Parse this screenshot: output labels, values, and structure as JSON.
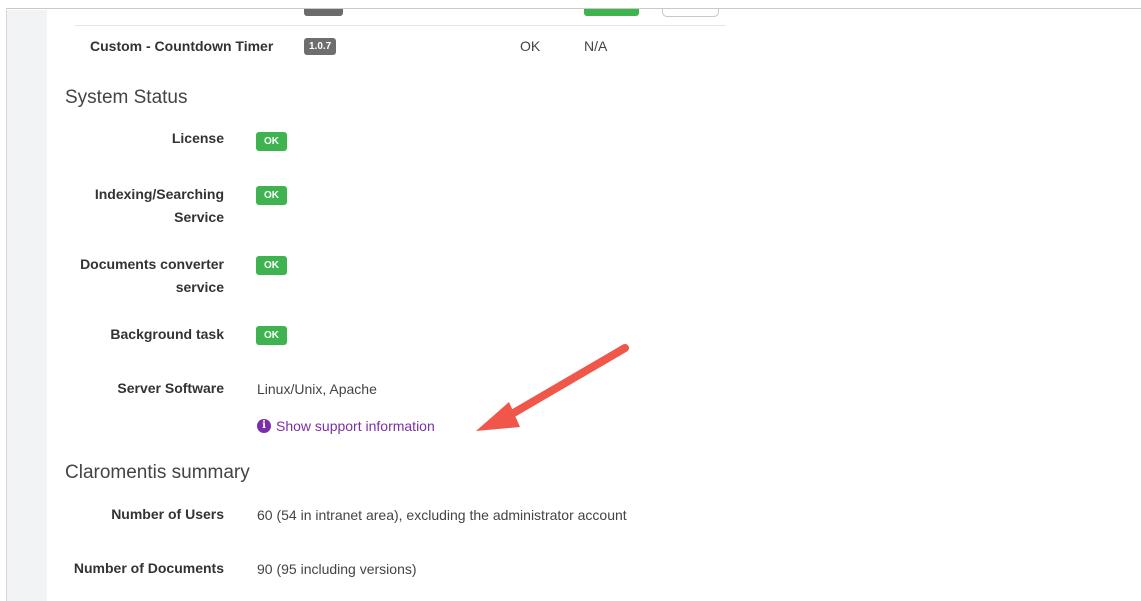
{
  "plugins": {
    "row": {
      "name": "Custom - Countdown Timer",
      "version": "1.0.7",
      "status": "OK",
      "extra": "N/A"
    }
  },
  "system_status": {
    "title": "System Status",
    "items": [
      {
        "label_line1": "License",
        "label_line2": "",
        "badge": "OK"
      },
      {
        "label_line1": "Indexing/Searching",
        "label_line2": "Service",
        "badge": "OK"
      },
      {
        "label_line1": "Documents converter",
        "label_line2": "service",
        "badge": "OK"
      },
      {
        "label_line1": "Background task",
        "label_line2": "",
        "badge": "OK"
      }
    ],
    "server_software": {
      "label": "Server Software",
      "value": "Linux/Unix, Apache"
    },
    "support_link": "Show support information"
  },
  "summary": {
    "title": "Claromentis summary",
    "users": {
      "label": "Number of Users",
      "value": "60 (54 in intranet area), excluding the administrator account"
    },
    "documents": {
      "label": "Number of Documents",
      "value": "90 (95 including versions)"
    }
  },
  "colors": {
    "ok_badge": "#3fb34f",
    "link": "#7a2fa8",
    "annotation_arrow": "#f0564a"
  },
  "icons": {
    "support": "info-circle-icon",
    "annotation": "arrow-icon"
  }
}
